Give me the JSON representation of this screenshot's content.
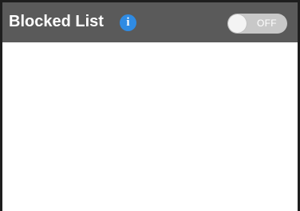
{
  "header": {
    "title": "Blocked List",
    "info_icon": "info-icon",
    "info_icon_glyph": "i",
    "toggle": {
      "label": "OFF",
      "state": "off"
    }
  },
  "list": {
    "items": []
  },
  "colors": {
    "header_background": "#5a5a5a",
    "info_icon": "#2f8be3",
    "toggle_track": "#c8c8c8",
    "border": "#1e1e1e"
  }
}
